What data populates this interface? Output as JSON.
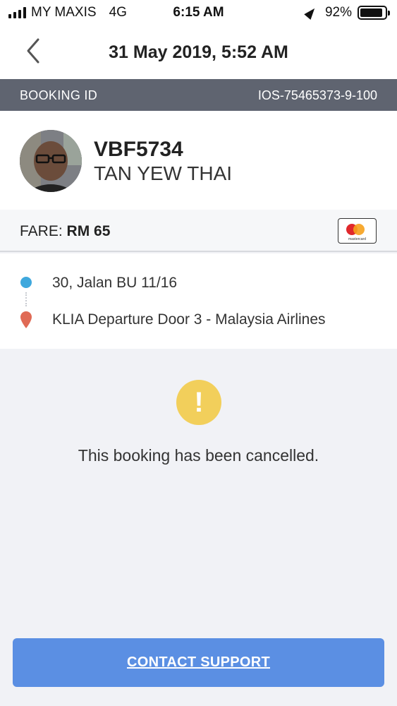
{
  "status_bar": {
    "carrier": "MY MAXIS",
    "network": "4G",
    "time": "6:15 AM",
    "battery": "92%",
    "battery_level": 0.92,
    "signal_bars": 4
  },
  "header": {
    "title": "31 May 2019, 5:52 AM",
    "back_icon": "chevron-left-icon"
  },
  "booking": {
    "id_label": "BOOKING ID",
    "id_value": "IOS-75465373-9-100"
  },
  "driver": {
    "plate": "VBF5734",
    "name": "TAN YEW THAI"
  },
  "fare": {
    "label": "FARE: ",
    "amount": "RM 65",
    "payment_icon": "mastercard-icon",
    "card_text": "mastercard"
  },
  "route": {
    "pickup": "30, Jalan BU 11/16",
    "dropoff": "KLIA Departure Door 3 - Malaysia Airlines"
  },
  "status": {
    "icon_glyph": "!",
    "message": "This booking has been cancelled."
  },
  "actions": {
    "contact_support": "CONTACT SUPPORT"
  },
  "colors": {
    "id_bar": "#5f6470",
    "pickup": "#3fa8dd",
    "dropoff": "#e06a55",
    "alert": "#f2cf5b",
    "button": "#5b8fe3"
  }
}
